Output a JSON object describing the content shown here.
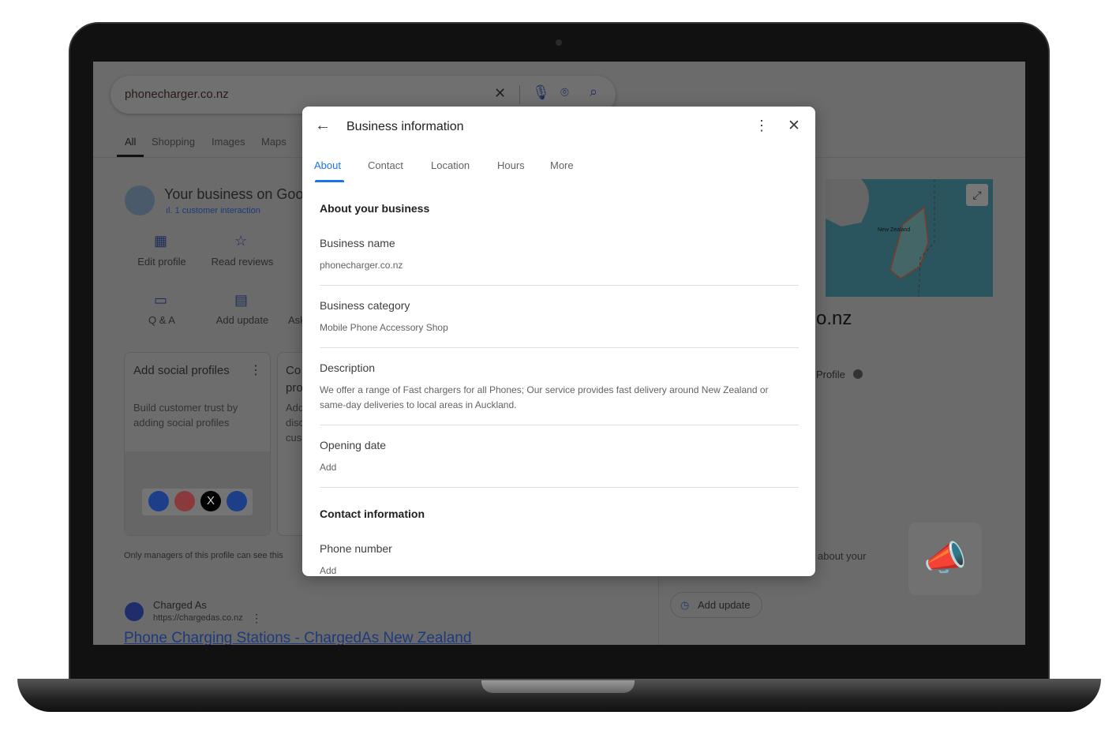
{
  "search": {
    "query": "phonecharger.co.nz"
  },
  "search_tabs": [
    "All",
    "Shopping",
    "Images",
    "Maps"
  ],
  "business_panel": {
    "title": "Your business on Goo",
    "interactions": "1 customer interaction",
    "actions": [
      "Edit profile",
      "Read reviews",
      "Q & A",
      "Add update",
      "Ask"
    ],
    "social_card": {
      "title": "Add social profiles",
      "body": "Build customer trust by adding social profiles"
    },
    "second_card": {
      "title": "Co",
      "lines": [
        "pro",
        "Add",
        "disc",
        "cus"
      ]
    },
    "footnote": "Only managers of this profile can see this"
  },
  "result": {
    "site": "Charged As",
    "url": "https://chargedas.co.nz",
    "title": "Phone Charging Stations - ChargedAs New Zealand"
  },
  "right_panel": {
    "map_label": "New Zealand",
    "name_fragment": "o.nz",
    "profile": "Profile",
    "about": "about your",
    "add_update": "Add update"
  },
  "dialog": {
    "title": "Business information",
    "tabs": [
      "About",
      "Contact",
      "Location",
      "Hours",
      "More"
    ],
    "active_tab": "About",
    "about_header": "About your business",
    "fields": [
      {
        "label": "Business name",
        "value": "phonecharger.co.nz"
      },
      {
        "label": "Business category",
        "value": "Mobile Phone Accessory Shop"
      },
      {
        "label": "Description",
        "value": "We offer a range of Fast chargers for all Phones; Our service provides fast delivery around New Zealand or same-day deliveries to local areas in Auckland."
      },
      {
        "label": "Opening date",
        "value": "Add"
      }
    ],
    "contact_header": "Contact information",
    "contact_fields": [
      {
        "label": "Phone number",
        "value": "Add"
      }
    ]
  },
  "colors": {
    "accent": "#1a73e8",
    "overlay": "#6b6b6b"
  }
}
